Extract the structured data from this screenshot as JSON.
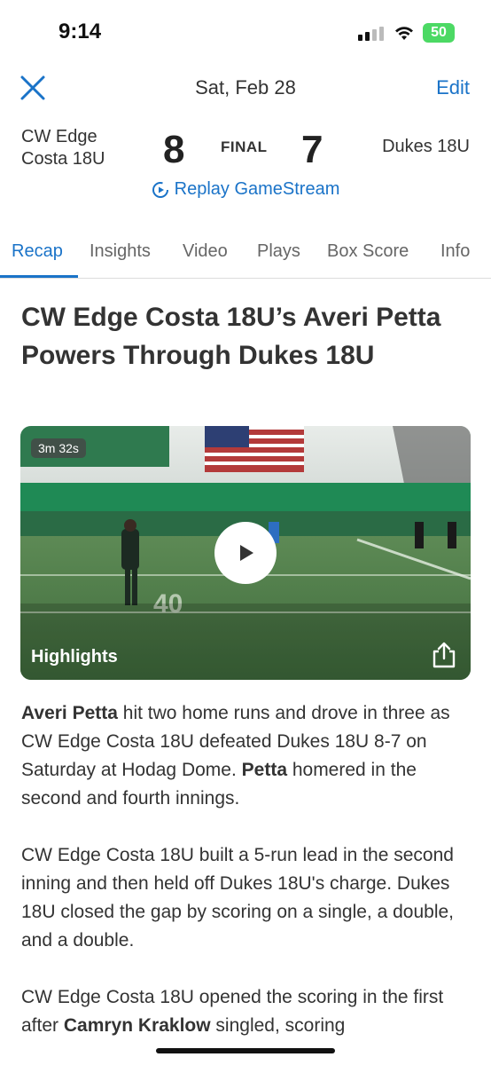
{
  "status": {
    "time": "9:14",
    "battery": "50"
  },
  "nav": {
    "date": "Sat, Feb 28",
    "edit_label": "Edit"
  },
  "score": {
    "home_team_line1": "CW Edge",
    "home_team_line2": "Costa 18U",
    "home_score": "8",
    "status": "FINAL",
    "away_score": "7",
    "away_team": "Dukes 18U"
  },
  "replay_label": "Replay GameStream",
  "tabs": [
    "Recap",
    "Insights",
    "Video",
    "Plays",
    "Box Score",
    "Info"
  ],
  "headline": "CW Edge Costa 18U’s Averi Petta Powers Through Dukes 18U",
  "video": {
    "duration": "3m 32s",
    "title": "Highlights"
  },
  "paragraphs": {
    "p1_bold1": "Averi Petta",
    "p1_text1": " hit two home runs and drove in three as CW Edge Costa 18U defeated Dukes 18U 8-7 on Saturday at Hodag Dome. ",
    "p1_bold2": "Petta",
    "p1_text2": " homered in the second and fourth innings.",
    "p2": "CW Edge Costa 18U built a 5-run lead in the second inning and then held off Dukes 18U's charge. Dukes 18U closed the gap by scoring on a single, a double, and a double.",
    "p3_text1": "CW Edge Costa 18U opened the scoring in the first after ",
    "p3_bold": "Camryn Kraklow",
    "p3_text2": " singled, scoring"
  },
  "colors": {
    "accent": "#1a73c8",
    "battery": "#4cd964"
  }
}
